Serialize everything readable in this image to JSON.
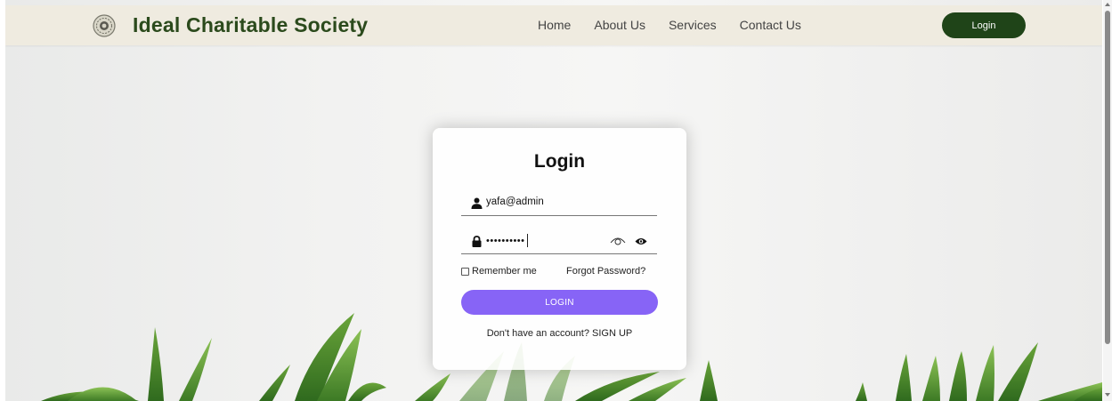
{
  "navbar": {
    "brand": "Ideal Charitable Society",
    "links": [
      "Home",
      "About Us",
      "Services",
      "Contact Us"
    ],
    "login_label": "Login",
    "logo_icon": "society-emblem-icon"
  },
  "login_card": {
    "title": "Login",
    "email_value": "yafa@admin",
    "password_mask": "••••••••••",
    "remember_label": "Remember me",
    "remember_checked": false,
    "forgot_label": "Forgot Password?",
    "submit_label": "LOGIN",
    "signup_prompt": "Don't have an account? SIGN UP"
  },
  "icons": {
    "user": "user-icon",
    "lock": "lock-icon",
    "toggle": "eye-outline-icon",
    "show": "eye-icon"
  },
  "colors": {
    "navbar_bg": "#efebe0",
    "brand_text": "#2b4a1c",
    "nav_login_bg": "#1f4418",
    "submit_bg": "#8764f6"
  }
}
